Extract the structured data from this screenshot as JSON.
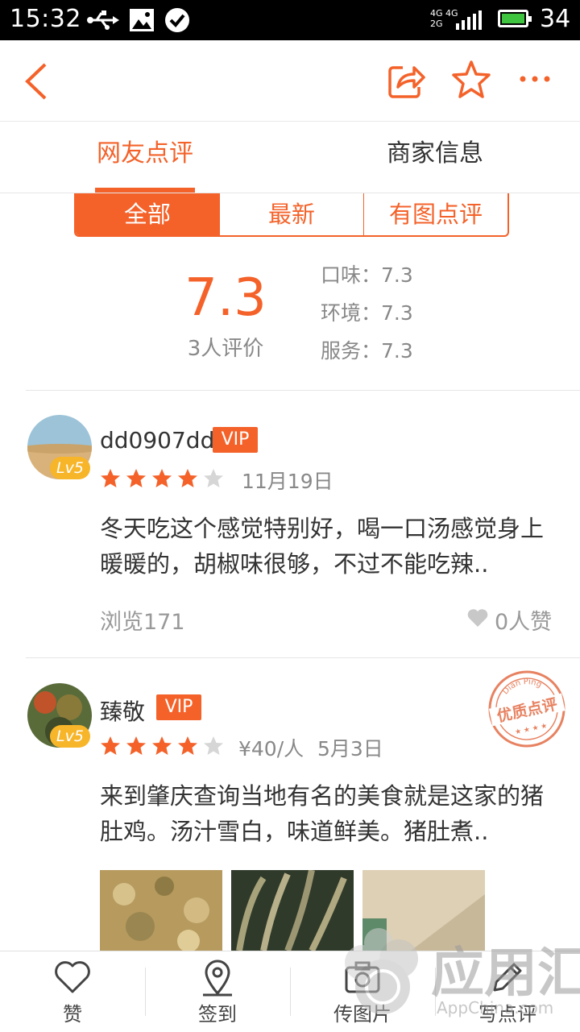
{
  "status": {
    "time": "15:32",
    "net_top": "4G 4G",
    "net_bottom": "2G",
    "battery": "34"
  },
  "tabs": {
    "active": "网友点评",
    "other": "商家信息"
  },
  "filters": [
    "全部",
    "最新",
    "有图点评"
  ],
  "rating": {
    "score": "7.3",
    "count": "3人评价",
    "taste": "口味：7.3",
    "environment": "环境：7.3",
    "service": "服务：7.3"
  },
  "reviews": [
    {
      "user": "dd0907dd",
      "vip": "VIP",
      "level": "Lv5",
      "stars": 4,
      "price": "",
      "date": "11月19日",
      "text": "冬天吃这个感觉特别好，喝一口汤感觉身上暖暖的，胡椒味很够，不过不能吃辣..",
      "views": "浏览171",
      "likes": "0人赞"
    },
    {
      "user": "臻敬",
      "vip": "VIP",
      "level": "Lv5",
      "stars": 4,
      "price": "¥40/人",
      "date": "5月3日",
      "text": "来到肇庆查询当地有名的美食就是这家的猪肚鸡。汤汁雪白，味道鲜美。猪肚煮..",
      "stamp_top": "Dian Ping",
      "stamp": "优质点评"
    }
  ],
  "bottom_nav": [
    "赞",
    "签到",
    "传图片",
    "写点评"
  ],
  "watermark": {
    "name": "应用汇",
    "site": "AppChina.com"
  },
  "colors": {
    "accent": "#f4622a",
    "vip": "#f4622a",
    "star": "#f4622a",
    "level": "#f7b52a"
  }
}
